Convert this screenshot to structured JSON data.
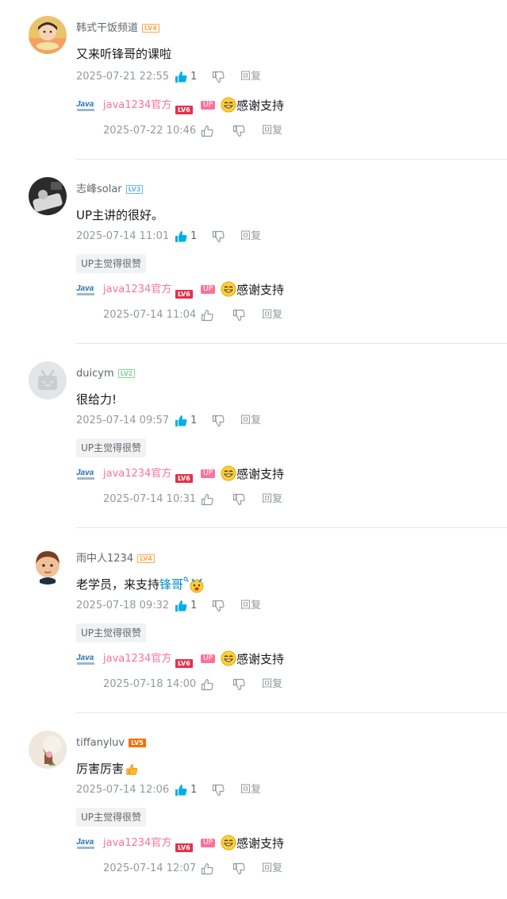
{
  "comments": [
    {
      "username": "韩式干饭频道",
      "level": "LV4",
      "text": "又来听锋哥的课啦",
      "time": "2025-07-21 22:55",
      "likes": "1",
      "reply_label": "回复",
      "badge": "",
      "reply": {
        "username": "java1234官方",
        "level": "LV6",
        "up_tag": "UP",
        "emoji": "grin-emoji",
        "text": "感谢支持",
        "time": "2025-07-22 10:46",
        "reply_label": "回复"
      }
    },
    {
      "username": "志峰solar",
      "level": "LV3",
      "text": "UP主讲的很好。",
      "time": "2025-07-14 11:01",
      "likes": "1",
      "reply_label": "回复",
      "badge": "UP主觉得很赞",
      "reply": {
        "username": "java1234官方",
        "level": "LV6",
        "up_tag": "UP",
        "emoji": "grin-emoji",
        "text": "感谢支持",
        "time": "2025-07-14 11:04",
        "reply_label": "回复"
      }
    },
    {
      "username": "duicym",
      "level": "LV2",
      "text": "很给力!",
      "time": "2025-07-14 09:57",
      "likes": "1",
      "reply_label": "回复",
      "badge": "UP主觉得很赞",
      "reply": {
        "username": "java1234官方",
        "level": "LV6",
        "up_tag": "UP",
        "emoji": "grin-emoji",
        "text": "感谢支持",
        "time": "2025-07-14 10:31",
        "reply_label": "回复"
      }
    },
    {
      "username": "雨中人1234",
      "level": "LV4",
      "text_prefix": "老学员，来支持",
      "text_link": "锋哥",
      "time": "2025-07-18 09:32",
      "likes": "1",
      "reply_label": "回复",
      "badge": "UP主觉得很赞",
      "reply": {
        "username": "java1234官方",
        "level": "LV6",
        "up_tag": "UP",
        "emoji": "grin-emoji",
        "text": "感谢支持",
        "time": "2025-07-18 14:00",
        "reply_label": "回复"
      }
    },
    {
      "username": "tiffanyluv",
      "level": "LV5",
      "text": "厉害厉害",
      "time": "2025-07-14 12:06",
      "likes": "1",
      "reply_label": "回复",
      "badge": "UP主觉得很赞",
      "reply": {
        "username": "java1234官方",
        "level": "LV6",
        "up_tag": "UP",
        "emoji": "grin-emoji",
        "text": "感谢支持",
        "time": "2025-07-14 12:07",
        "reply_label": "回复"
      }
    }
  ],
  "colors": {
    "accent_link": "#008ac5",
    "up_pink": "#fb7299",
    "like_blue": "#00aeec",
    "lv4": "#ffa84c",
    "lv3": "#6ab9e8",
    "lv2": "#8bd29b",
    "lv5": "#ff6c00",
    "lv6": "#e5314a"
  }
}
